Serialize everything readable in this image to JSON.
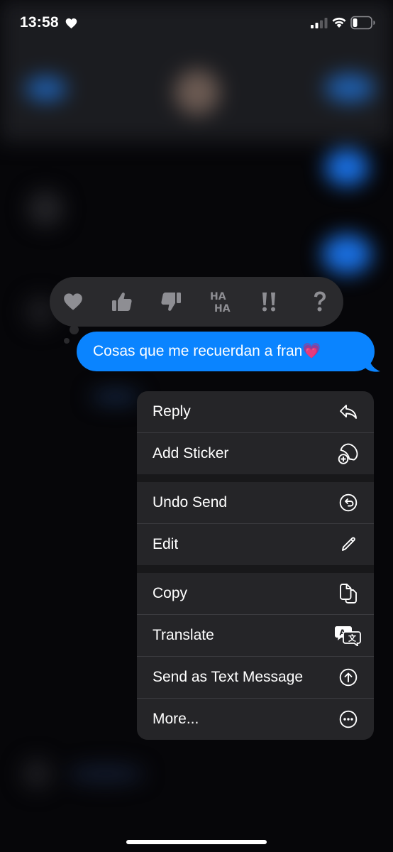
{
  "status_bar": {
    "time": "13:58",
    "status_icons": [
      "heart-icon",
      "cellular-signal-icon",
      "wifi-icon",
      "battery-icon"
    ]
  },
  "tapbacks": [
    {
      "name": "love",
      "icon": "heart-icon"
    },
    {
      "name": "like",
      "icon": "thumbs-up-icon"
    },
    {
      "name": "dislike",
      "icon": "thumbs-down-icon"
    },
    {
      "name": "laugh",
      "label": "HA HA",
      "icon": "haha-icon"
    },
    {
      "name": "emphasize",
      "label": "!!",
      "icon": "exclamation-icon"
    },
    {
      "name": "question",
      "label": "?",
      "icon": "question-icon"
    }
  ],
  "message": {
    "text": "Cosas que me recuerdan a fran💗",
    "color": "#0a84ff"
  },
  "menu": {
    "items": [
      {
        "label": "Reply",
        "icon": "reply-arrow-icon"
      },
      {
        "label": "Add Sticker",
        "icon": "sticker-add-icon"
      },
      {
        "label": "Undo Send",
        "icon": "undo-circle-icon"
      },
      {
        "label": "Edit",
        "icon": "pencil-icon"
      },
      {
        "label": "Copy",
        "icon": "copy-icon"
      },
      {
        "label": "Translate",
        "icon": "translate-icon"
      },
      {
        "label": "Send as Text Message",
        "icon": "arrow-up-circle-icon"
      },
      {
        "label": "More...",
        "icon": "ellipsis-circle-icon"
      }
    ]
  },
  "colors": {
    "background": "#060609",
    "menu_background": "#252528",
    "tapback_background": "#2a2a2d",
    "accent_blue": "#0a84ff"
  }
}
